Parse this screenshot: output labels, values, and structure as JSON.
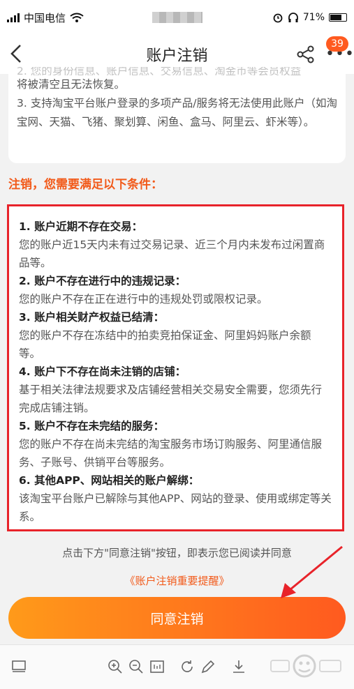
{
  "status_bar": {
    "carrier": "中国电信",
    "battery": "71%"
  },
  "header": {
    "title": "账户注销",
    "badge_count": "39"
  },
  "intro": {
    "line_faded": "2. 您的身份信息、账户信息、交易信息、淘金币等会员权益",
    "line2": "将被清空且无法恢复。",
    "point3": "3. 支持淘宝平台账户登录的多项产品/服务将无法使用此账户（如淘宝网、天猫、飞猪、聚划算、闲鱼、盒马、阿里云、虾米等）。"
  },
  "conditions_title": "注销，您需要满足以下条件：",
  "conditions": [
    {
      "title": "1. 账户近期不存在交易：",
      "desc": "您的账户近15天内未有过交易记录、近三个月内未发布过闲置商品等。"
    },
    {
      "title": "2. 账户不存在进行中的违规记录：",
      "desc": "您的账户不存在正在进行中的违规处罚或限权记录。"
    },
    {
      "title": "3. 账户相关财产权益已结清：",
      "desc": "您的账户不存在冻结中的拍卖竞拍保证金、阿里妈妈账户余额等。"
    },
    {
      "title": "4. 账户下不存在尚未注销的店铺：",
      "desc": "基于相关法律法规要求及店铺经营相关交易安全需要，您须先行完成店铺注销。"
    },
    {
      "title": "5. 账户不存在未完结的服务：",
      "desc": "您的账户不存在尚未完结的淘宝服务市场订购服务、阿里通信服务、子账号、供销平台等服务。"
    },
    {
      "title": "6. 其他APP、网站相关的账户解绑：",
      "desc": "该淘宝平台账户已解除与其他APP、网站的登录、使用或绑定等关系。"
    }
  ],
  "agree_note": "点击下方\"同意注销\"按钮，即表示您已阅读并同意",
  "agree_link": "《账户注销重要提醒》",
  "agree_button": "同意注销",
  "colors": {
    "accent": "#f25a1a",
    "highlight_border": "#e8232a",
    "button_start": "#ff9a1a",
    "button_end": "#ff5a1f"
  }
}
